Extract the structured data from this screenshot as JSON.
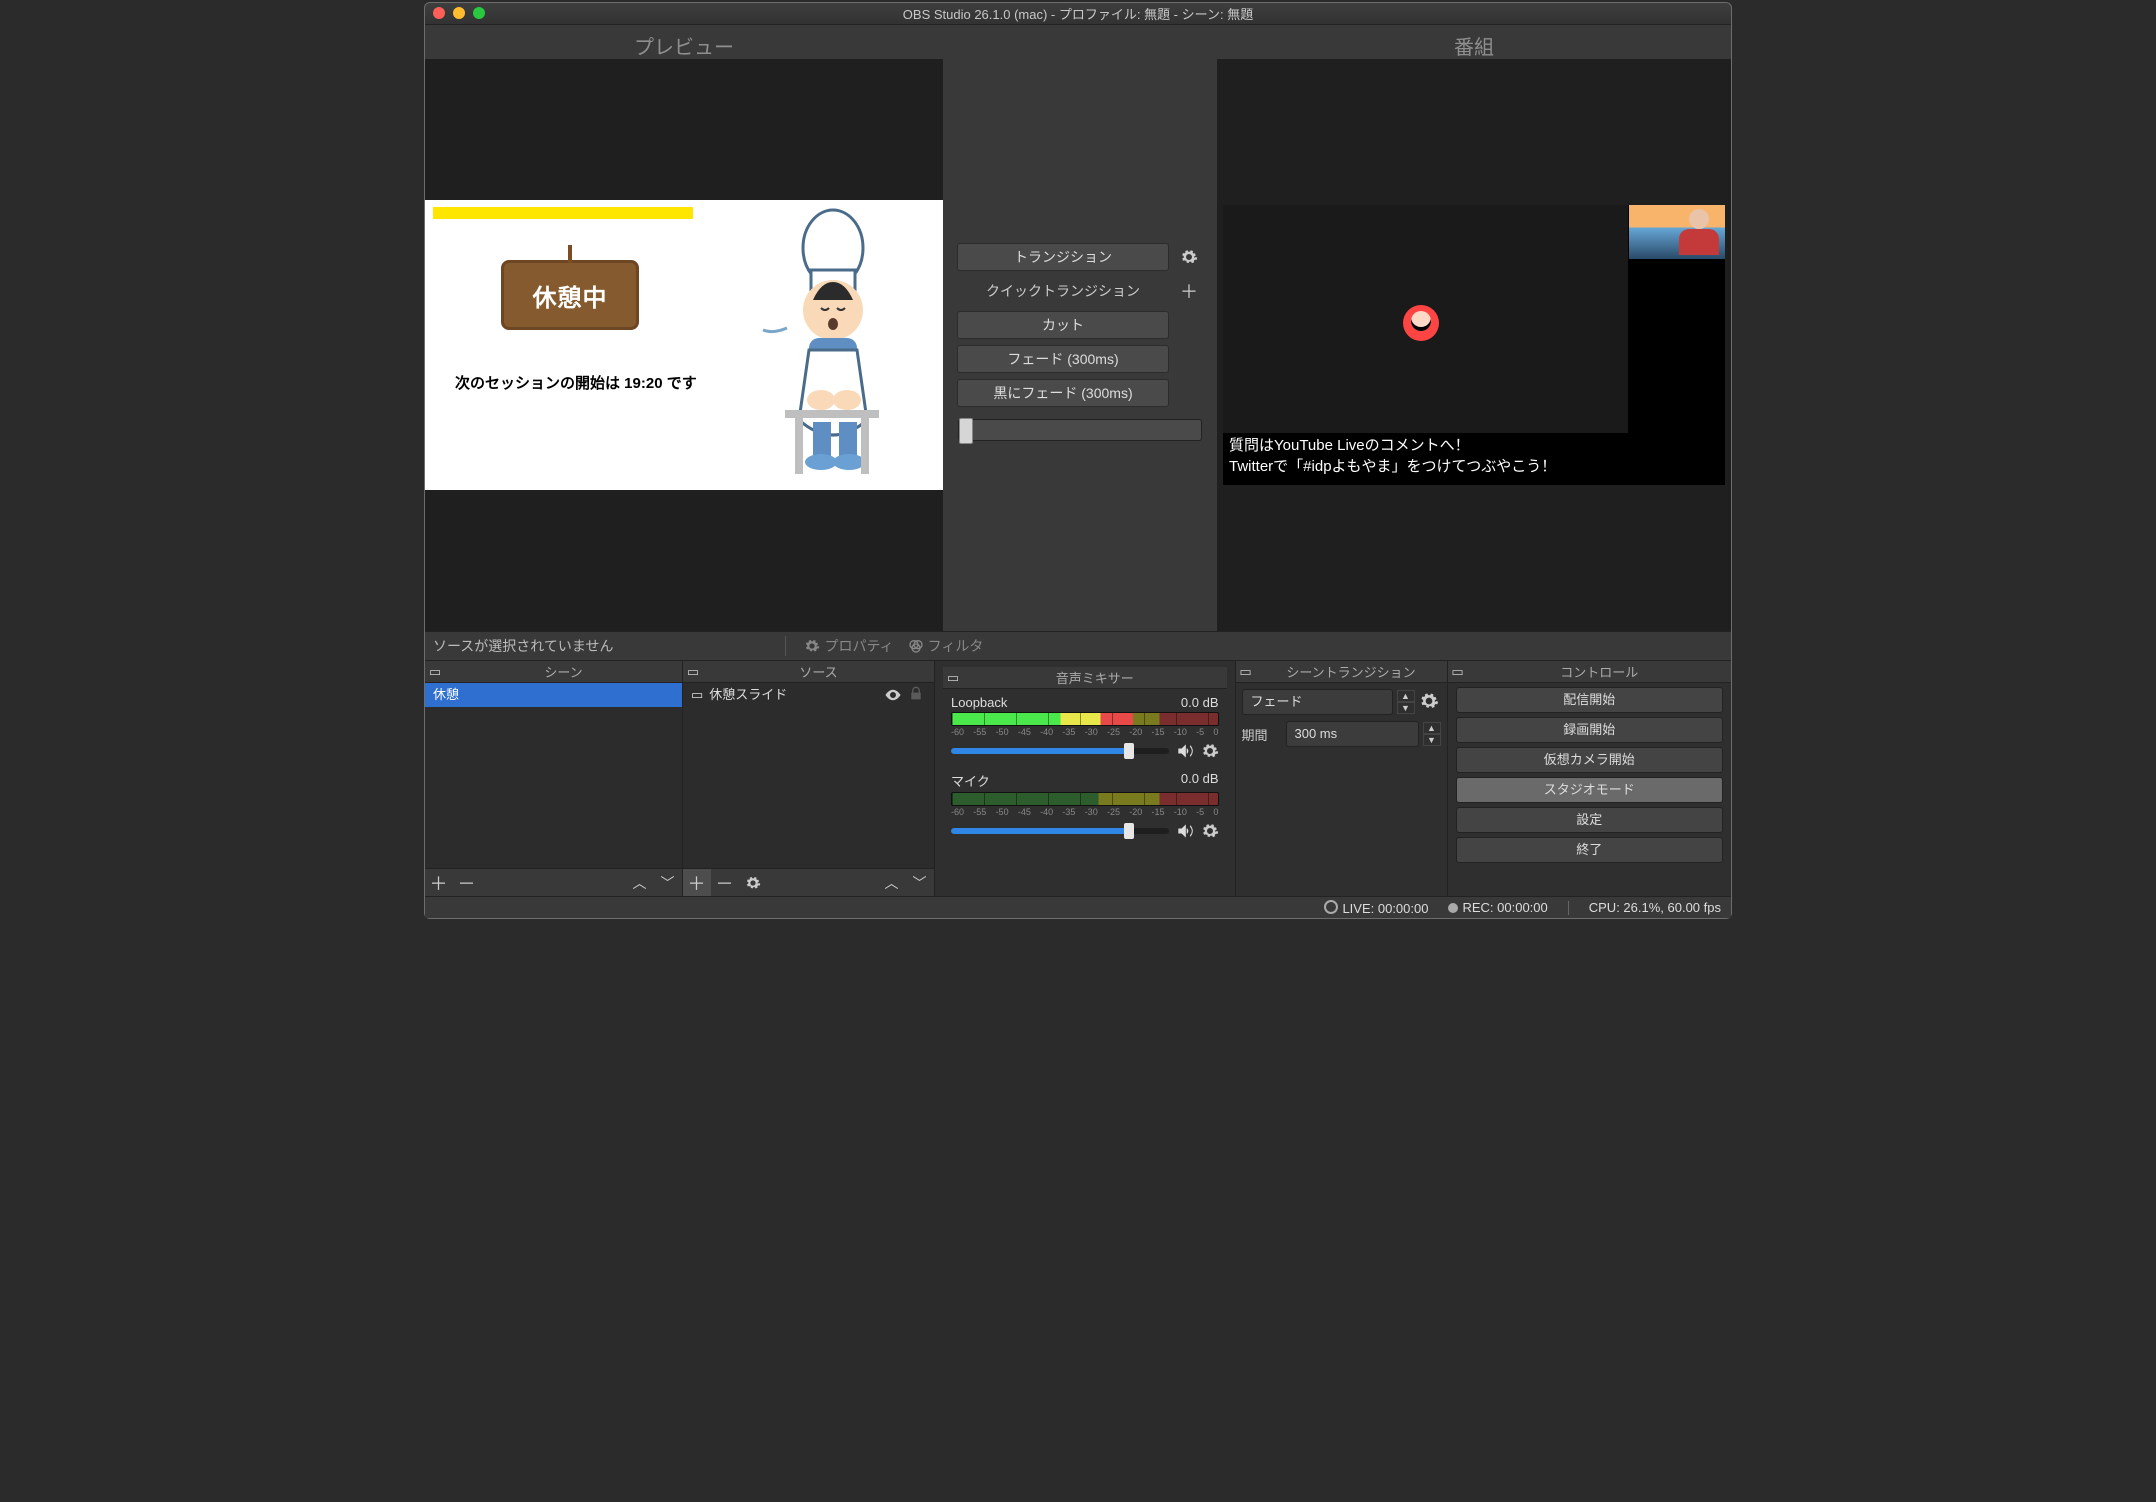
{
  "window_title": "OBS Studio 26.1.0 (mac) - プロファイル: 無題 - シーン: 無題",
  "preview": {
    "title": "プレビュー",
    "slide_sign": "休憩中",
    "slide_msg": "次のセッションの開始は 19:20 です"
  },
  "program": {
    "title": "番組",
    "line1": "質問はYouTube Liveのコメントへ！",
    "line2": "Twitterで「#idpよもやま」をつけてつぶやこう！"
  },
  "transitions": {
    "main_btn": "トランジション",
    "quick_label": "クイックトランジション",
    "items": [
      "カット",
      "フェード (300ms)",
      "黒にフェード (300ms)"
    ]
  },
  "source_toolbar": {
    "no_selection": "ソースが選択されていません",
    "properties": "プロパティ",
    "filters": "フィルタ"
  },
  "docks": {
    "scenes": {
      "title": "シーン",
      "items": [
        "休憩"
      ]
    },
    "sources": {
      "title": "ソース",
      "items": [
        "休憩スライド"
      ]
    },
    "mixer": {
      "title": "音声ミキサー",
      "channels": [
        {
          "name": "Loopback",
          "db": "0.0 dB",
          "ticks": [
            "-60",
            "-55",
            "-50",
            "-45",
            "-40",
            "-35",
            "-30",
            "-25",
            "-20",
            "-15",
            "-10",
            "-5",
            "0"
          ]
        },
        {
          "name": "マイク",
          "db": "0.0 dB",
          "ticks": [
            "-60",
            "-55",
            "-50",
            "-45",
            "-40",
            "-35",
            "-30",
            "-25",
            "-20",
            "-15",
            "-10",
            "-5",
            "0"
          ]
        }
      ]
    },
    "scene_trans": {
      "title": "シーントランジション",
      "selected": "フェード",
      "duration_label": "期間",
      "duration_val": "300 ms"
    },
    "controls": {
      "title": "コントロール",
      "buttons": [
        "配信開始",
        "録画開始",
        "仮想カメラ開始",
        "スタジオモード",
        "設定",
        "終了"
      ],
      "active_index": 3
    }
  },
  "status": {
    "live": "LIVE: 00:00:00",
    "rec": "REC: 00:00:00",
    "cpu": "CPU: 26.1%, 60.00 fps"
  }
}
